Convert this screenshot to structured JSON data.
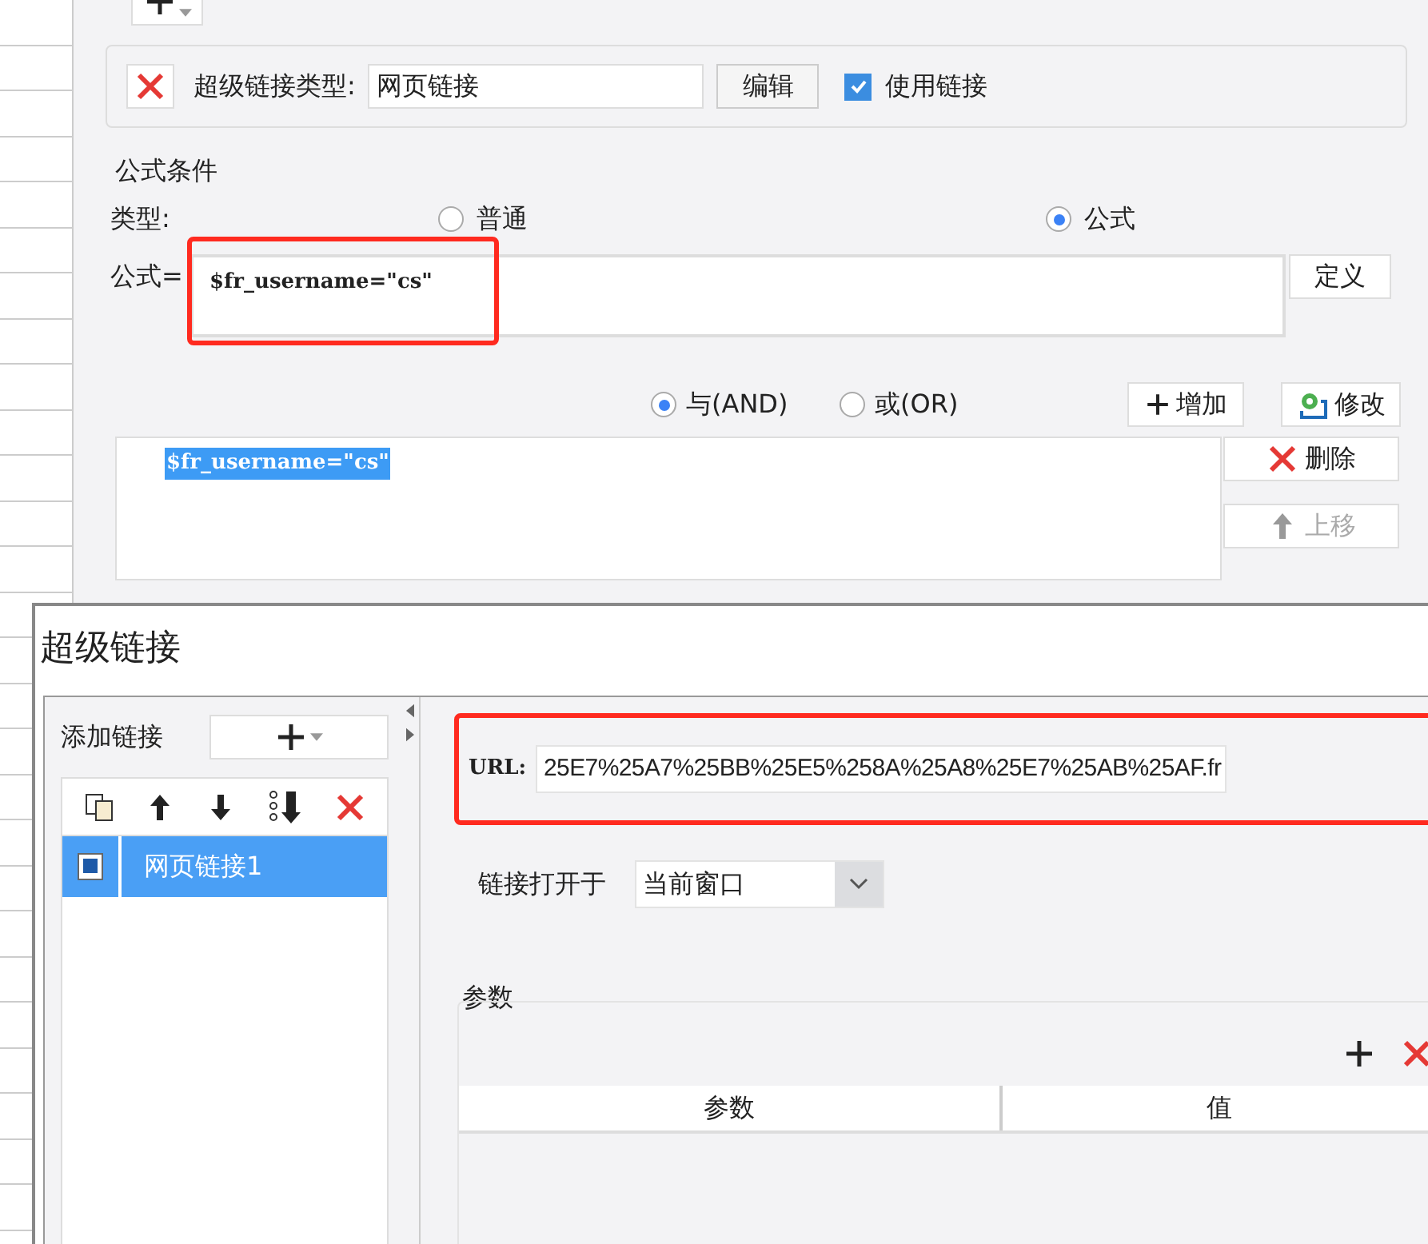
{
  "back_dialog": {
    "link_type": {
      "label": "超级链接类型:",
      "value": "网页链接",
      "edit_button": "编辑",
      "use_link": {
        "label": "使用链接",
        "checked": true
      }
    },
    "formula_condition": {
      "title": "公式条件",
      "type_label": "类型:",
      "types": [
        {
          "label": "普通",
          "selected": false
        },
        {
          "label": "公式",
          "selected": true
        }
      ],
      "formula_label": "公式=",
      "formula_value": "$fr_username=\"cs\"",
      "define_button": "定义",
      "operators": [
        {
          "label": "与(AND)",
          "selected": true
        },
        {
          "label": "或(OR)",
          "selected": false
        }
      ],
      "add_button": "增加",
      "modify_button": "修改",
      "conditions": [
        {
          "text": "$fr_username=\"cs\"",
          "selected": true
        }
      ],
      "side_buttons": [
        {
          "kind": "delete",
          "label": "删除",
          "disabled": false
        },
        {
          "kind": "up",
          "label": "上移",
          "disabled": true
        }
      ]
    }
  },
  "front_dialog": {
    "title": "超级链接",
    "add_link_label": "添加链接",
    "links": [
      {
        "label": "网页链接1",
        "selected": true
      }
    ],
    "url_label": "URL:",
    "url_value": "25E7%25A7%25BB%25E5%258A%25A8%25E7%25AB%25AF.fr",
    "open_in_label": "链接打开于",
    "open_in_value": "当前窗口",
    "params": {
      "title": "参数",
      "columns": [
        "参数",
        "值"
      ]
    }
  }
}
